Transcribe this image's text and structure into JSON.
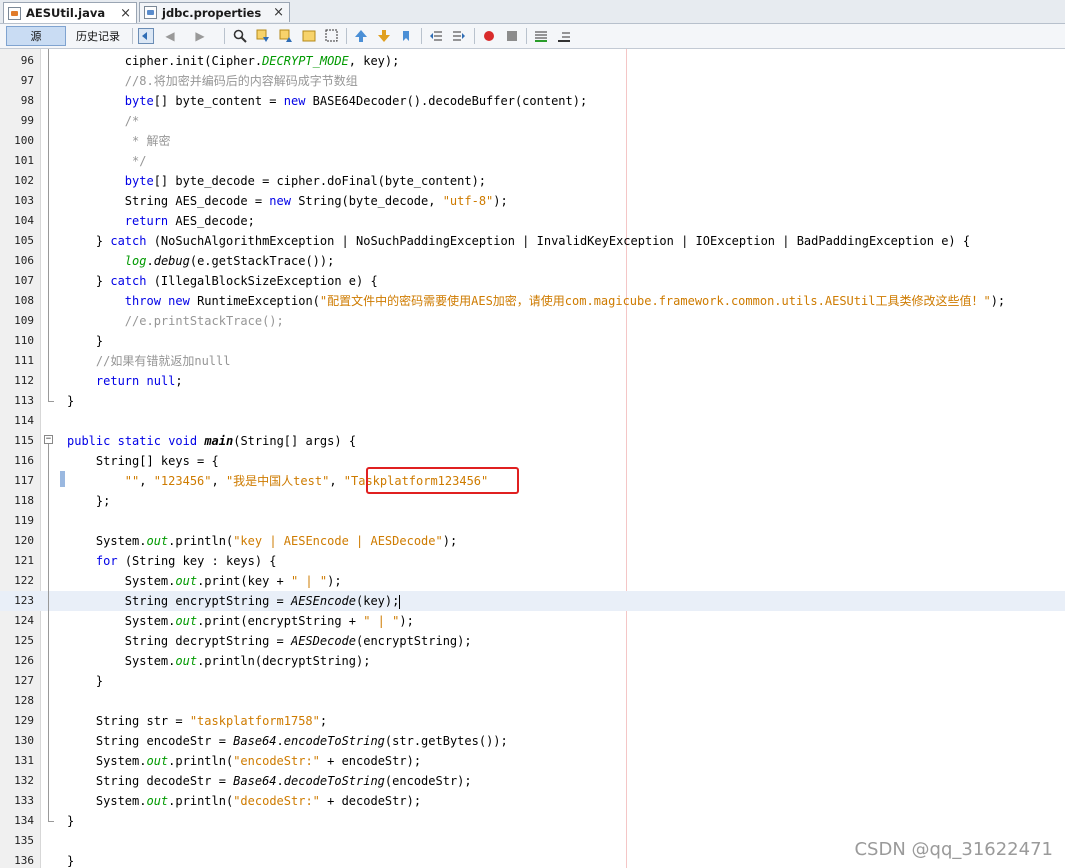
{
  "tabs": [
    {
      "label": "AESUtil.java",
      "close": "×"
    },
    {
      "label": "jdbc.properties",
      "close": "×"
    }
  ],
  "toolbar": {
    "source_label": "源",
    "history_label": "历史记录"
  },
  "editor": {
    "lines": [
      {
        "n": "96",
        "segs": [
          [
            "        cipher.init(Cipher.",
            ""
          ],
          [
            "DECRYPT_MODE",
            "fld italic"
          ],
          [
            ", key);",
            ""
          ]
        ]
      },
      {
        "n": "97",
        "segs": [
          [
            "        //8.将加密并编码后的内容解码成字节数组",
            "cm"
          ]
        ]
      },
      {
        "n": "98",
        "segs": [
          [
            "        ",
            ""
          ],
          [
            "byte",
            "kw"
          ],
          [
            "[] byte_content = ",
            ""
          ],
          [
            "new",
            "kw"
          ],
          [
            " BASE64Decoder().decodeBuffer(content);",
            ""
          ]
        ]
      },
      {
        "n": "99",
        "segs": [
          [
            "        /*",
            "cm"
          ]
        ]
      },
      {
        "n": "100",
        "segs": [
          [
            "         * 解密",
            "cm"
          ]
        ]
      },
      {
        "n": "101",
        "segs": [
          [
            "         */",
            "cm"
          ]
        ]
      },
      {
        "n": "102",
        "segs": [
          [
            "        ",
            ""
          ],
          [
            "byte",
            "kw"
          ],
          [
            "[] byte_decode = cipher.doFinal(byte_content);",
            ""
          ]
        ]
      },
      {
        "n": "103",
        "segs": [
          [
            "        String AES_decode = ",
            ""
          ],
          [
            "new",
            "kw"
          ],
          [
            " String(byte_decode, ",
            ""
          ],
          [
            "\"utf-8\"",
            "str"
          ],
          [
            ");",
            ""
          ]
        ]
      },
      {
        "n": "104",
        "segs": [
          [
            "        ",
            ""
          ],
          [
            "return",
            "kw"
          ],
          [
            " AES_decode;",
            ""
          ]
        ]
      },
      {
        "n": "105",
        "segs": [
          [
            "    } ",
            ""
          ],
          [
            "catch",
            "kw"
          ],
          [
            " (NoSuchAlgorithmException | NoSuchPaddingException | InvalidKeyException | IOException | BadPaddingException e) {",
            ""
          ]
        ]
      },
      {
        "n": "106",
        "segs": [
          [
            "        ",
            ""
          ],
          [
            "log",
            "fld italic"
          ],
          [
            ".",
            ""
          ],
          [
            "debug",
            "italic"
          ],
          [
            "(e.getStackTrace());",
            ""
          ]
        ]
      },
      {
        "n": "107",
        "segs": [
          [
            "    } ",
            ""
          ],
          [
            "catch",
            "kw"
          ],
          [
            " (IllegalBlockSizeException e) {",
            ""
          ]
        ]
      },
      {
        "n": "108",
        "segs": [
          [
            "        ",
            ""
          ],
          [
            "throw",
            "kw"
          ],
          [
            " ",
            ""
          ],
          [
            "new",
            "kw"
          ],
          [
            " RuntimeException(",
            ""
          ],
          [
            "\"配置文件中的密码需要使用AES加密，请使用com.magicube.framework.common.utils.AESUtil工具类修改这些值！\"",
            "str"
          ],
          [
            ");",
            ""
          ]
        ]
      },
      {
        "n": "109",
        "segs": [
          [
            "        //e.printStackTrace();",
            "cm"
          ]
        ]
      },
      {
        "n": "110",
        "segs": [
          [
            "    }",
            ""
          ]
        ]
      },
      {
        "n": "111",
        "segs": [
          [
            "    //如果有错就返加nulll",
            "cm"
          ]
        ]
      },
      {
        "n": "112",
        "segs": [
          [
            "    ",
            ""
          ],
          [
            "return",
            "kw"
          ],
          [
            " ",
            ""
          ],
          [
            "null",
            "kw"
          ],
          [
            ";",
            ""
          ]
        ]
      },
      {
        "n": "113",
        "segs": [
          [
            "}",
            ""
          ]
        ]
      },
      {
        "n": "114",
        "segs": []
      },
      {
        "n": "115",
        "segs": [
          [
            "",
            ""
          ],
          [
            "public",
            "kw"
          ],
          [
            " ",
            ""
          ],
          [
            "static",
            "kw"
          ],
          [
            " ",
            ""
          ],
          [
            "void",
            "kw"
          ],
          [
            " ",
            ""
          ],
          [
            "main",
            "bold italic"
          ],
          [
            "(String[] args) {",
            ""
          ]
        ]
      },
      {
        "n": "116",
        "segs": [
          [
            "    String[] keys = {",
            ""
          ]
        ]
      },
      {
        "n": "117",
        "segs": [
          [
            "        ",
            ""
          ],
          [
            "\"\"",
            "str"
          ],
          [
            ", ",
            ""
          ],
          [
            "\"123456\"",
            "str"
          ],
          [
            ", ",
            ""
          ],
          [
            "\"我是中国人test\"",
            "str"
          ],
          [
            ", ",
            ""
          ],
          [
            "\"Taskplatform123456\"",
            "str"
          ]
        ]
      },
      {
        "n": "118",
        "segs": [
          [
            "    };",
            ""
          ]
        ]
      },
      {
        "n": "119",
        "segs": []
      },
      {
        "n": "120",
        "segs": [
          [
            "    System.",
            ""
          ],
          [
            "out",
            "fld italic"
          ],
          [
            ".println(",
            ""
          ],
          [
            "\"key | AESEncode | AESDecode\"",
            "str"
          ],
          [
            ");",
            ""
          ]
        ]
      },
      {
        "n": "121",
        "segs": [
          [
            "    ",
            ""
          ],
          [
            "for",
            "kw"
          ],
          [
            " (String key : keys) {",
            ""
          ]
        ]
      },
      {
        "n": "122",
        "segs": [
          [
            "        System.",
            ""
          ],
          [
            "out",
            "fld italic"
          ],
          [
            ".print(key + ",
            ""
          ],
          [
            "\" | \"",
            "str"
          ],
          [
            ");",
            ""
          ]
        ]
      },
      {
        "n": "123",
        "segs": [
          [
            "        String encryptString = ",
            ""
          ],
          [
            "AESEncode",
            "italic"
          ],
          [
            "(key);",
            ""
          ]
        ]
      },
      {
        "n": "124",
        "segs": [
          [
            "        System.",
            ""
          ],
          [
            "out",
            "fld italic"
          ],
          [
            ".print(encryptString + ",
            ""
          ],
          [
            "\" | \"",
            "str"
          ],
          [
            ");",
            ""
          ]
        ]
      },
      {
        "n": "125",
        "segs": [
          [
            "        String decryptString = ",
            ""
          ],
          [
            "AESDecode",
            "italic"
          ],
          [
            "(encryptString);",
            ""
          ]
        ]
      },
      {
        "n": "126",
        "segs": [
          [
            "        System.",
            ""
          ],
          [
            "out",
            "fld italic"
          ],
          [
            ".println(decryptString);",
            ""
          ]
        ]
      },
      {
        "n": "127",
        "segs": [
          [
            "    }",
            ""
          ]
        ]
      },
      {
        "n": "128",
        "segs": []
      },
      {
        "n": "129",
        "segs": [
          [
            "    String str = ",
            ""
          ],
          [
            "\"taskplatform1758\"",
            "str"
          ],
          [
            ";",
            ""
          ]
        ]
      },
      {
        "n": "130",
        "segs": [
          [
            "    String encodeStr = ",
            ""
          ],
          [
            "Base64",
            "italic"
          ],
          [
            ".",
            ""
          ],
          [
            "encodeToString",
            "italic"
          ],
          [
            "(str.getBytes());",
            ""
          ]
        ]
      },
      {
        "n": "131",
        "segs": [
          [
            "    System.",
            ""
          ],
          [
            "out",
            "fld italic"
          ],
          [
            ".println(",
            ""
          ],
          [
            "\"encodeStr:\"",
            "str"
          ],
          [
            " + encodeStr);",
            ""
          ]
        ]
      },
      {
        "n": "132",
        "segs": [
          [
            "    String decodeStr = ",
            ""
          ],
          [
            "Base64",
            "italic"
          ],
          [
            ".",
            ""
          ],
          [
            "decodeToString",
            "italic"
          ],
          [
            "(encodeStr);",
            ""
          ]
        ]
      },
      {
        "n": "133",
        "segs": [
          [
            "    System.",
            ""
          ],
          [
            "out",
            "fld italic"
          ],
          [
            ".println(",
            ""
          ],
          [
            "\"decodeStr:\"",
            "str"
          ],
          [
            " + decodeStr);",
            ""
          ]
        ]
      },
      {
        "n": "134",
        "segs": [
          [
            "}",
            ""
          ]
        ]
      },
      {
        "n": "135",
        "segs": []
      },
      {
        "n": "136",
        "segs": [
          [
            "}",
            ""
          ]
        ]
      }
    ],
    "current_line": "123"
  },
  "watermark": "CSDN @qq_31622471"
}
